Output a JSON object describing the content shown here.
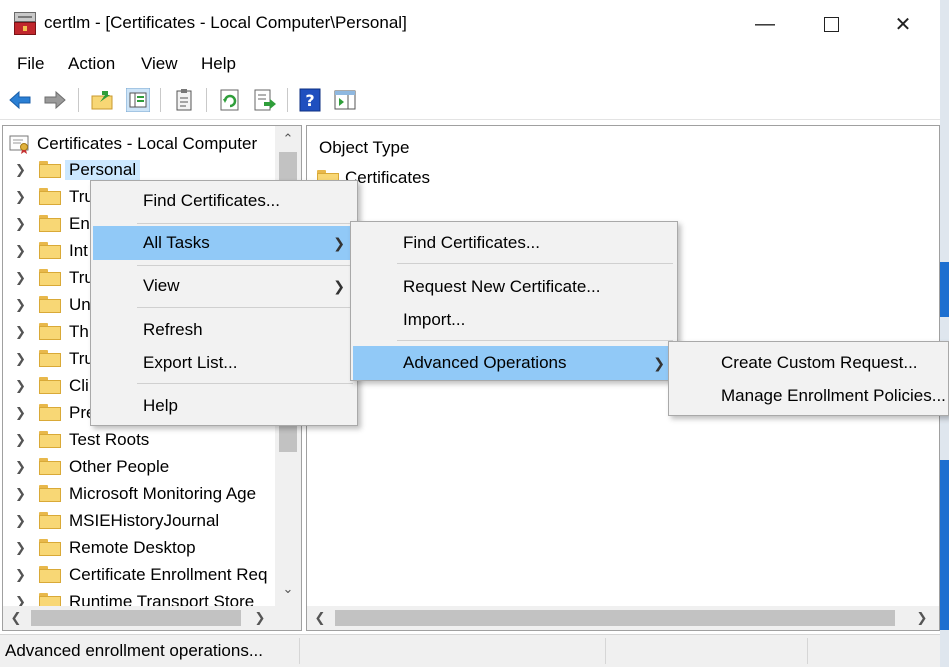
{
  "window": {
    "title": "certlm - [Certificates - Local Computer\\Personal]"
  },
  "menubar": {
    "file": "File",
    "action": "Action",
    "view": "View",
    "help": "Help"
  },
  "toolbar": {
    "icons": [
      "back-icon",
      "forward-icon",
      "up-folder-icon",
      "show-hide-tree-icon",
      "properties-icon",
      "refresh-icon",
      "export-list-icon",
      "help-icon",
      "action-pane-icon"
    ]
  },
  "tree": {
    "root_label": "Certificates - Local Computer",
    "items": [
      {
        "label": "Personal"
      },
      {
        "label": "Tru"
      },
      {
        "label": "En"
      },
      {
        "label": "Int"
      },
      {
        "label": "Tru"
      },
      {
        "label": "Un"
      },
      {
        "label": "Th"
      },
      {
        "label": "Tru"
      },
      {
        "label": "Cli"
      },
      {
        "label": "Pre"
      },
      {
        "label": "Test Roots"
      },
      {
        "label": "Other People"
      },
      {
        "label": "Microsoft Monitoring Age"
      },
      {
        "label": "MSIEHistoryJournal"
      },
      {
        "label": "Remote Desktop"
      },
      {
        "label": "Certificate Enrollment Req"
      },
      {
        "label": "Runtime Transport Store"
      }
    ]
  },
  "content": {
    "column_header": "Object Type",
    "rows": [
      {
        "label": "Certificates"
      }
    ]
  },
  "context_menu": {
    "items": [
      {
        "label": "Find Certificates..."
      },
      {
        "label": "All Tasks"
      },
      {
        "label": "View"
      },
      {
        "label": "Refresh"
      },
      {
        "label": "Export List..."
      },
      {
        "label": "Help"
      }
    ]
  },
  "all_tasks_menu": {
    "items": [
      {
        "label": "Find Certificates..."
      },
      {
        "label": "Request New Certificate..."
      },
      {
        "label": "Import..."
      },
      {
        "label": "Advanced Operations"
      }
    ]
  },
  "advanced_menu": {
    "items": [
      {
        "label": "Create Custom Request..."
      },
      {
        "label": "Manage Enrollment Policies..."
      }
    ]
  },
  "statusbar": {
    "text": "Advanced enrollment operations..."
  },
  "colors": {
    "highlight": "#91c9f7",
    "selection": "#cce8ff",
    "folder": "#f8d775"
  }
}
